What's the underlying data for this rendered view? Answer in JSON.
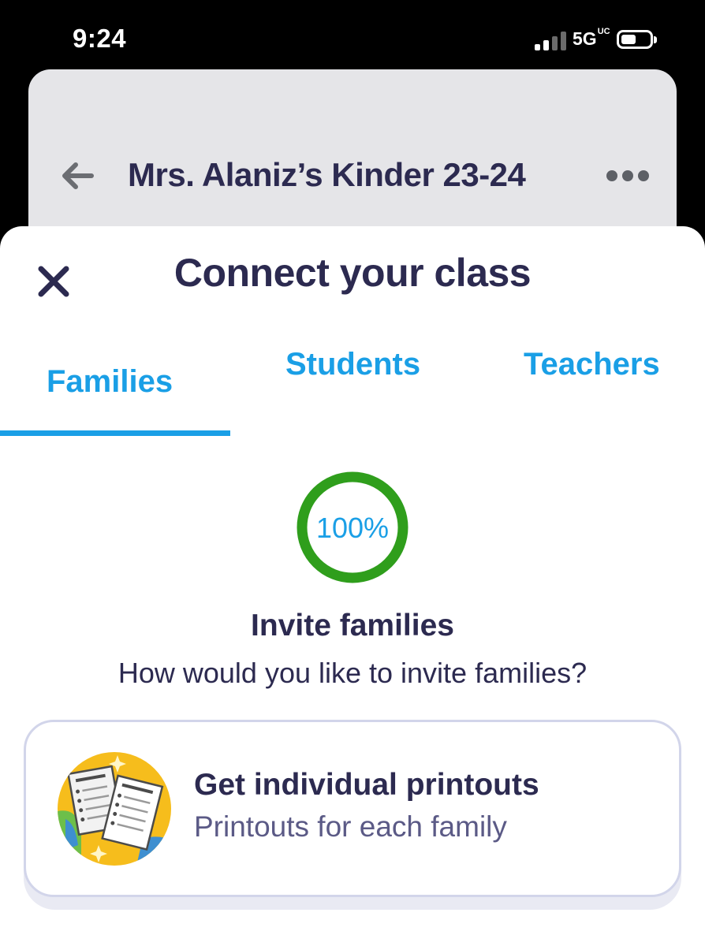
{
  "status_bar": {
    "time": "9:24",
    "network": "5G",
    "network_sup": "UC"
  },
  "background_screen": {
    "title": "Mrs. Alaniz’s Kinder 23-24"
  },
  "sheet": {
    "title": "Connect your class",
    "tabs": [
      {
        "label": "Families",
        "active": true
      },
      {
        "label": "Students",
        "active": false
      },
      {
        "label": "Teachers",
        "active": false
      }
    ],
    "progress": {
      "label": "100%",
      "value": 1.0
    },
    "heading": "Invite families",
    "subheading": "How would you like to invite families?",
    "option": {
      "title": "Get individual printouts",
      "subtitle": "Printouts for each family"
    }
  },
  "colors": {
    "accent": "#1a9fe6",
    "title_text": "#2c2a50",
    "progress_ring": "#2f9e1c",
    "icon_yellow": "#f6bd1c",
    "card_border": "#d2d5ea"
  },
  "icons": [
    "back-arrow-icon",
    "more-dots-icon",
    "close-icon",
    "printouts-illustration-icon"
  ]
}
